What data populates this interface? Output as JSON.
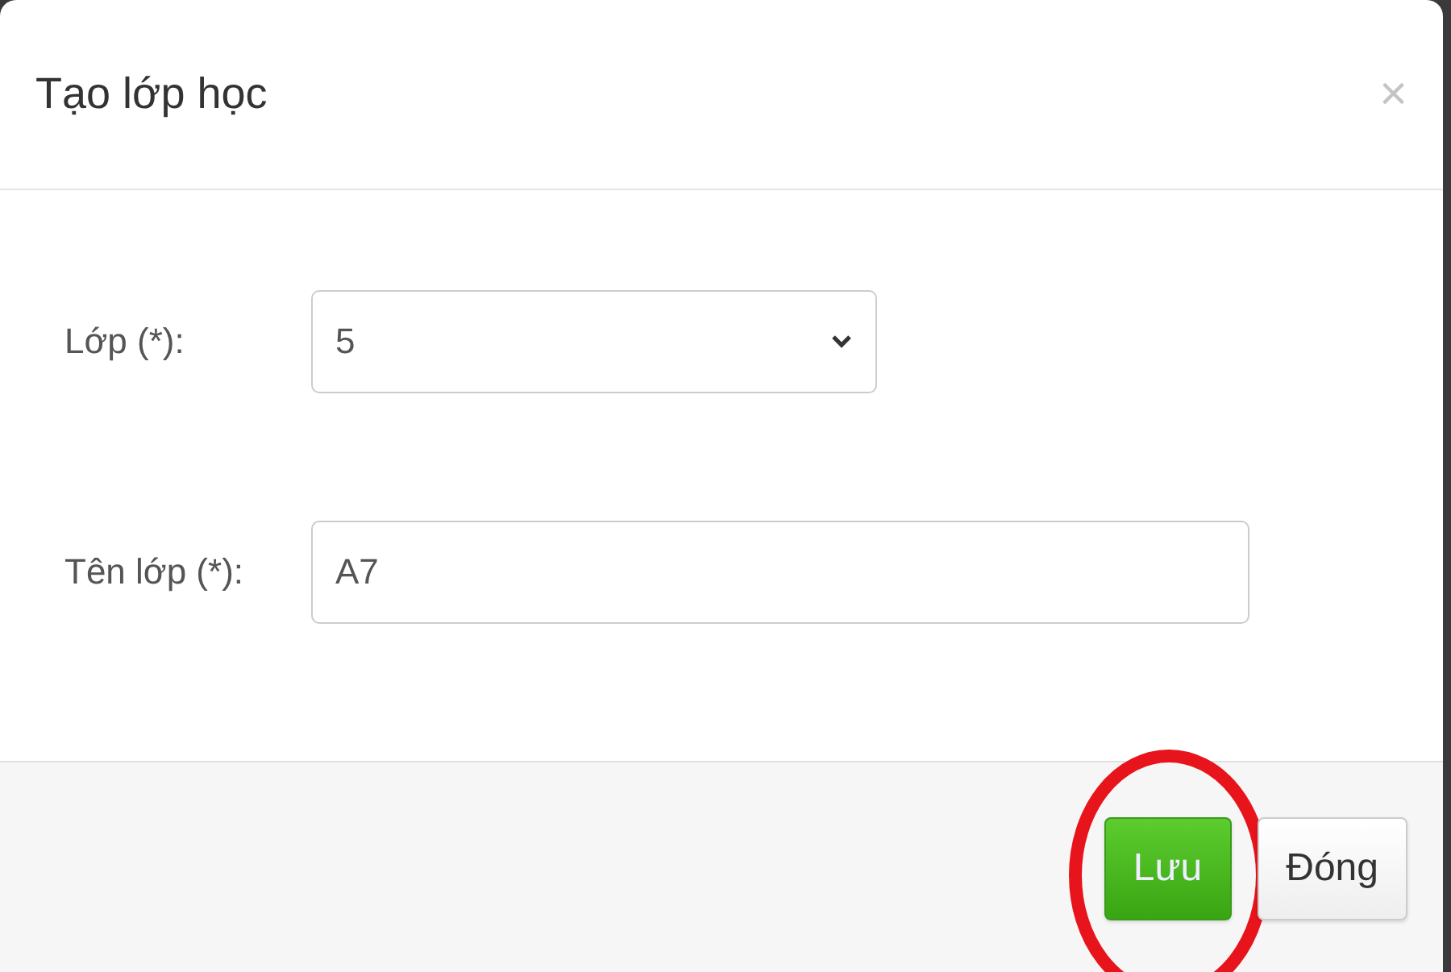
{
  "dialog": {
    "title": "Tạo lớp học",
    "close": "×"
  },
  "fields": [
    {
      "kind": "select",
      "label": "Lớp (*):",
      "value": "5"
    },
    {
      "kind": "text",
      "label": "Tên lớp (*):",
      "value": "A7"
    }
  ],
  "buttons": [
    {
      "label": "Lưu",
      "kind": "primary",
      "highlighted": true
    },
    {
      "label": "Đóng",
      "kind": "default",
      "highlighted": false
    }
  ]
}
